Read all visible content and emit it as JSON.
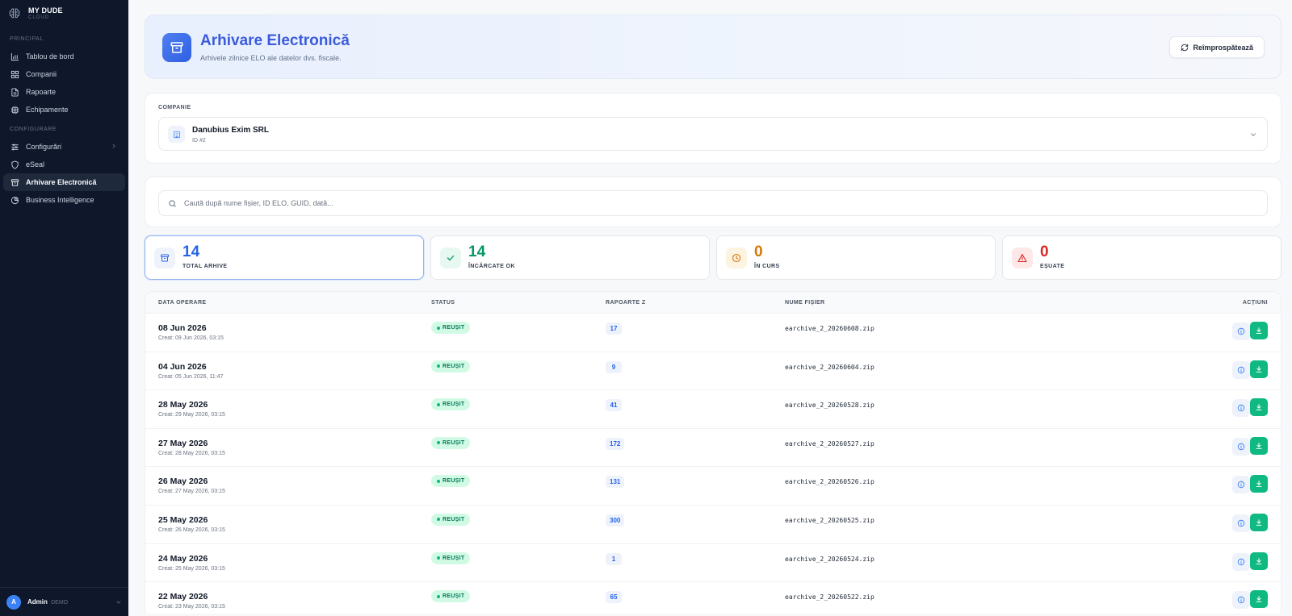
{
  "brand": {
    "name": "MY DUDE",
    "sub": "CLOUD",
    "logo_icon": "brain-icon"
  },
  "sidebar": {
    "section_principal": "PRINCIPAL",
    "section_config": "CONFIGURARE",
    "items": [
      {
        "label": "Tablou de bord",
        "icon": "bar-chart-icon"
      },
      {
        "label": "Companii",
        "icon": "grid-icon"
      },
      {
        "label": "Rapoarte",
        "icon": "document-icon"
      },
      {
        "label": "Echipamente",
        "icon": "chip-icon"
      },
      {
        "label": "Configurări",
        "icon": "sliders-icon"
      },
      {
        "label": "eSeal",
        "icon": "shield-icon"
      },
      {
        "label": "Arhivare Electronică",
        "icon": "archive-icon",
        "active": true
      },
      {
        "label": "Business Intelligence",
        "icon": "pie-chart-icon"
      }
    ],
    "user": {
      "initial": "A",
      "name": "Admin",
      "role": "DEMO"
    }
  },
  "header": {
    "title": "Arhivare Electronică",
    "subtitle": "Arhivele zilnice ELO ale datelor dvs. fiscale.",
    "refresh_label": "Reîmprospătează"
  },
  "company": {
    "label": "COMPANIE",
    "name": "Danubius Exim SRL",
    "id": "ID #2"
  },
  "search": {
    "placeholder": "Caută după nume fișier, ID ELO, GUID, dată...",
    "value": ""
  },
  "stats": [
    {
      "value": "14",
      "label": "TOTAL ARHIVE",
      "color": "#2563eb",
      "bg": "#eef2fb",
      "icon": "archive-icon"
    },
    {
      "value": "14",
      "label": "ÎNCĂRCATE OK",
      "color": "#059669",
      "bg": "#e7f8f1",
      "icon": "check-icon"
    },
    {
      "value": "0",
      "label": "ÎN CURS",
      "color": "#d97706",
      "bg": "#fdf3e1",
      "icon": "clock-icon"
    },
    {
      "value": "0",
      "label": "EȘUATE",
      "color": "#dc2626",
      "bg": "#fde8e8",
      "icon": "warning-icon"
    }
  ],
  "table": {
    "columns": [
      "DATA OPERARE",
      "STATUS",
      "RAPOARTE Z",
      "NUME FIȘIER",
      "ACȚIUNI"
    ],
    "rows": [
      {
        "date": "08 Jun 2026",
        "created": "Creat: 09 Jun 2026, 03:15",
        "status": "REUȘIT",
        "reports": "17",
        "file": "earchive_2_20260608.zip"
      },
      {
        "date": "04 Jun 2026",
        "created": "Creat: 05 Jun 2026, 11:47",
        "status": "REUȘIT",
        "reports": "9",
        "file": "earchive_2_20260604.zip"
      },
      {
        "date": "28 May 2026",
        "created": "Creat: 29 May 2026, 03:15",
        "status": "REUȘIT",
        "reports": "41",
        "file": "earchive_2_20260528.zip"
      },
      {
        "date": "27 May 2026",
        "created": "Creat: 28 May 2026, 03:15",
        "status": "REUȘIT",
        "reports": "172",
        "file": "earchive_2_20260527.zip"
      },
      {
        "date": "26 May 2026",
        "created": "Creat: 27 May 2026, 03:15",
        "status": "REUȘIT",
        "reports": "131",
        "file": "earchive_2_20260526.zip"
      },
      {
        "date": "25 May 2026",
        "created": "Creat: 26 May 2026, 03:15",
        "status": "REUȘIT",
        "reports": "300",
        "file": "earchive_2_20260525.zip"
      },
      {
        "date": "24 May 2026",
        "created": "Creat: 25 May 2026, 03:15",
        "status": "REUȘIT",
        "reports": "1",
        "file": "earchive_2_20260524.zip"
      },
      {
        "date": "22 May 2026",
        "created": "Creat: 23 May 2026, 03:15",
        "status": "REUȘIT",
        "reports": "65",
        "file": "earchive_2_20260522.zip"
      }
    ]
  }
}
